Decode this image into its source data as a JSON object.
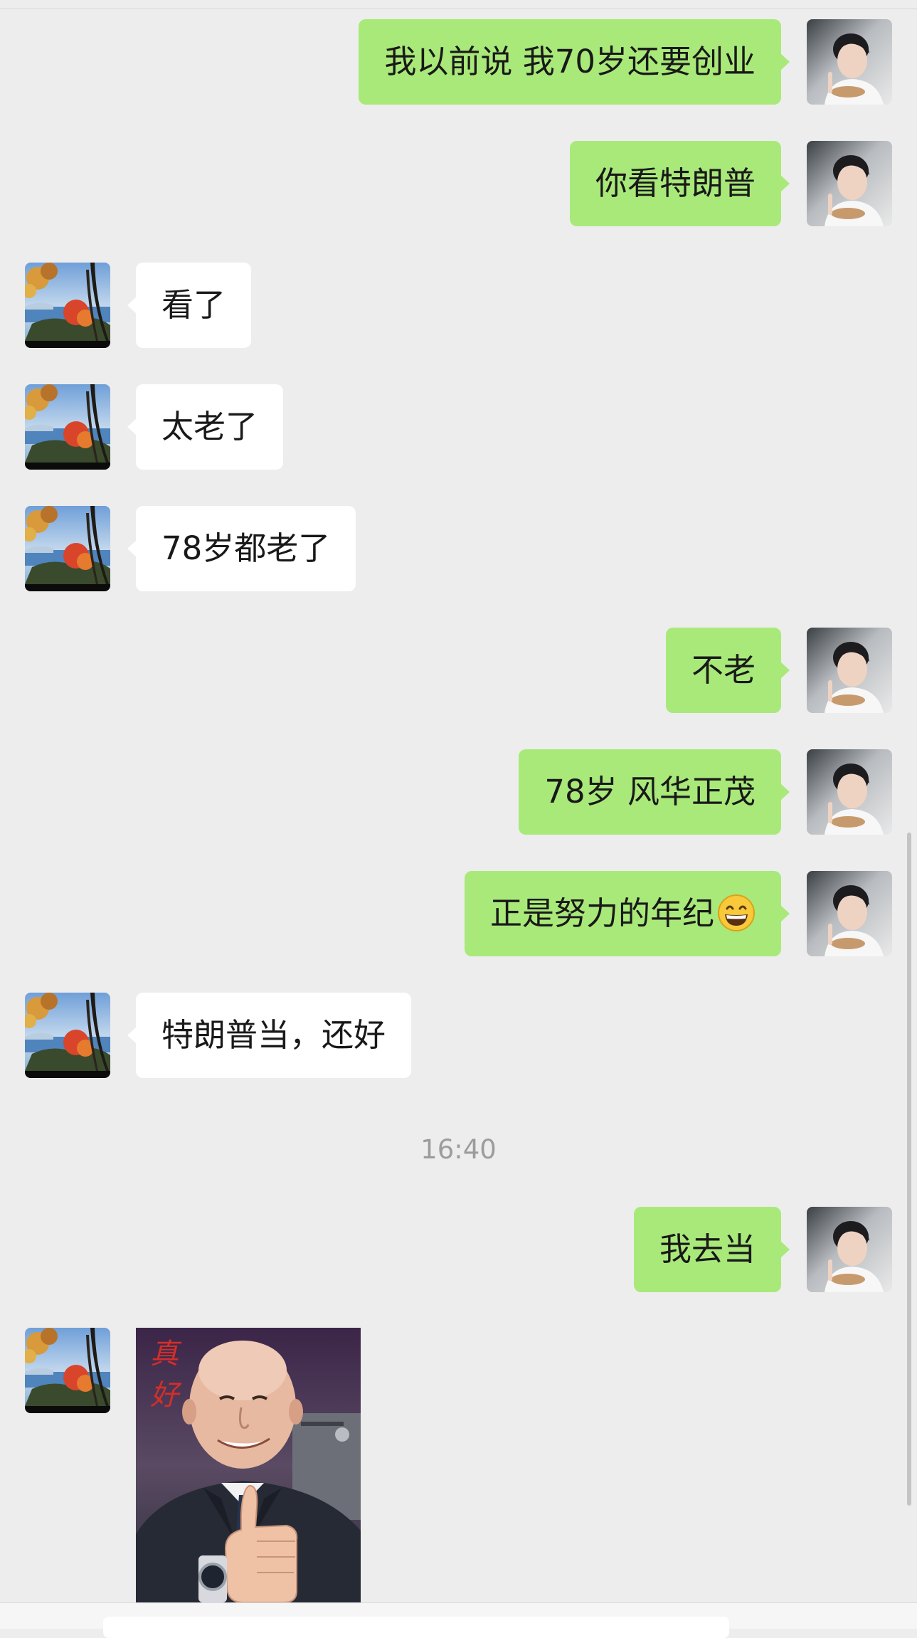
{
  "messages": [
    {
      "side": "out",
      "text": "我以前说 我70岁还要创业"
    },
    {
      "side": "out",
      "text": "你看特朗普"
    },
    {
      "side": "in",
      "text": "看了"
    },
    {
      "side": "in",
      "text": "太老了"
    },
    {
      "side": "in",
      "text": "78岁都老了"
    },
    {
      "side": "out",
      "text": "不老"
    },
    {
      "side": "out",
      "text": "78岁 风华正茂"
    },
    {
      "side": "out",
      "text": "正是努力的年纪",
      "emoji": "grinning-face-emoji"
    },
    {
      "side": "in",
      "text": "特朗普当，还好"
    },
    {
      "side": "out",
      "text": "我去当"
    }
  ],
  "timestamp": "16:40",
  "sticker": {
    "caption": "真好",
    "icon": "thumbs-up-sticker"
  },
  "avatars": {
    "self": "person-portrait-avatar",
    "other": "autumn-lake-landscape-avatar"
  },
  "colors": {
    "background": "#ededed",
    "outgoing_bubble": "#a9e97a",
    "incoming_bubble": "#ffffff",
    "timestamp": "#9c9c9c"
  }
}
